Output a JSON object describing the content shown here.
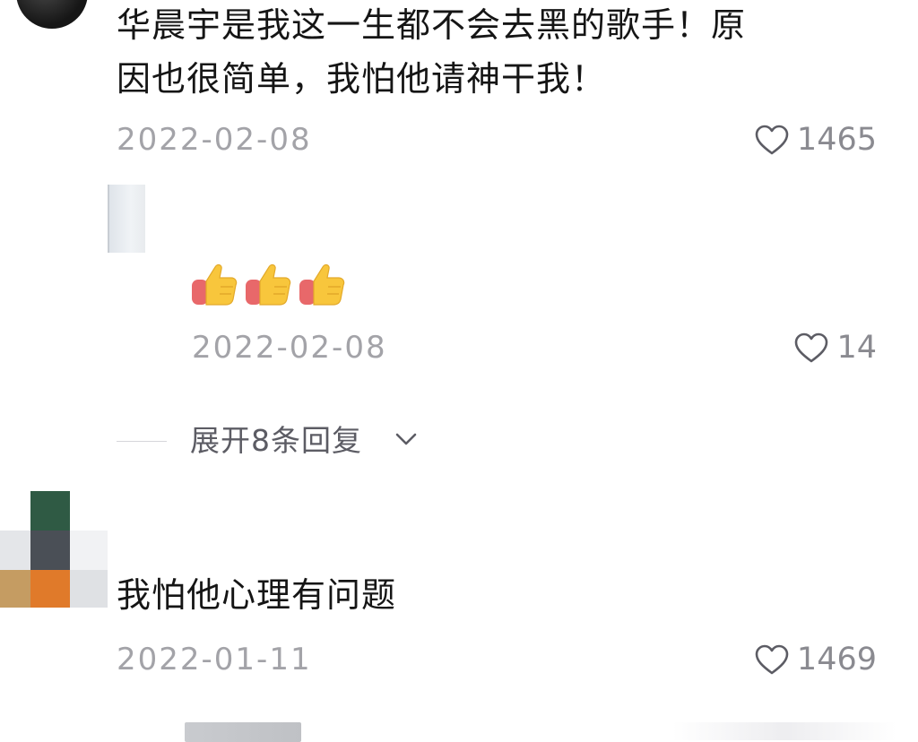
{
  "comments": [
    {
      "text_line1": "华晨宇是我这一生都不会去黑的歌手！原",
      "text_line2": "因也很简单，我怕他请神干我！",
      "date": "2022-02-08",
      "likes": "1465"
    },
    {
      "emoji": [
        "thumbs-up",
        "thumbs-up",
        "thumbs-up"
      ],
      "date": "2022-02-08",
      "likes": "14"
    },
    {
      "text_line1": "我怕他心理有问题",
      "date": "2022-01-11",
      "likes": "1469"
    }
  ],
  "expand_replies": {
    "label": "展开8条回复"
  },
  "colors": {
    "text": "#151515",
    "meta": "#a3a3a8",
    "like": "#8a8a90"
  },
  "icons": {
    "like": "heart-outline-icon",
    "expand": "chevron-down-icon"
  }
}
